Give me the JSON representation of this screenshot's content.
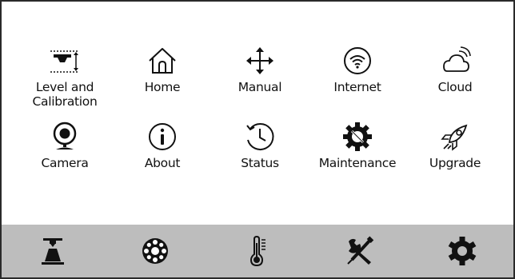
{
  "menu": {
    "items": [
      {
        "label": "Level and\nCalibration",
        "icon": "level-calibration-icon"
      },
      {
        "label": "Home",
        "icon": "home-icon"
      },
      {
        "label": "Manual",
        "icon": "move-arrows-icon"
      },
      {
        "label": "Internet",
        "icon": "wifi-icon"
      },
      {
        "label": "Cloud",
        "icon": "cloud-icon"
      },
      {
        "label": "Camera",
        "icon": "webcam-icon"
      },
      {
        "label": "About",
        "icon": "info-icon"
      },
      {
        "label": "Status",
        "icon": "history-clock-icon"
      },
      {
        "label": "Maintenance",
        "icon": "gear-wrench-icon"
      },
      {
        "label": "Upgrade",
        "icon": "rocket-icon"
      }
    ]
  },
  "bottom_bar": {
    "items": [
      {
        "icon": "print-nozzle-icon"
      },
      {
        "icon": "filament-spool-icon"
      },
      {
        "icon": "thermometer-icon"
      },
      {
        "icon": "tools-icon"
      },
      {
        "icon": "settings-gear-icon"
      }
    ]
  },
  "colors": {
    "background": "#ffffff",
    "bottom_bar": "#bdbdbd",
    "icon": "#111111"
  }
}
